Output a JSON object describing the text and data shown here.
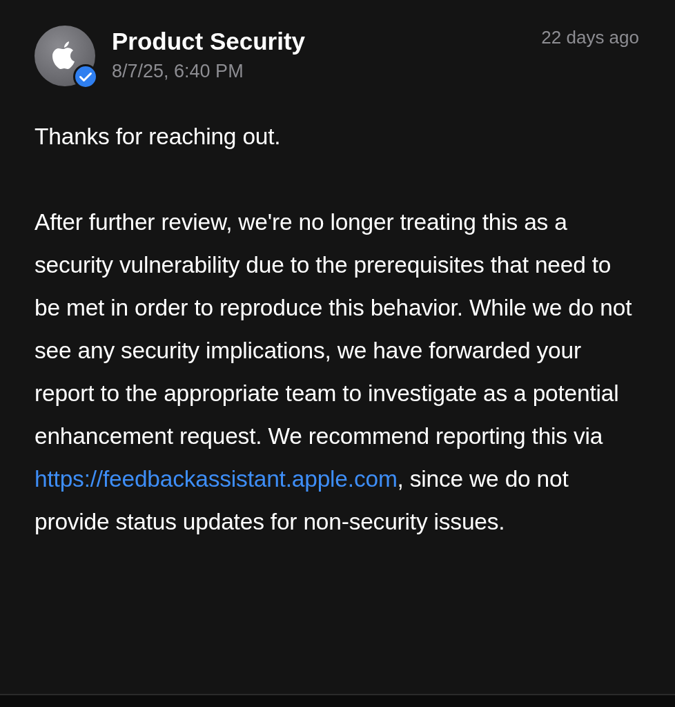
{
  "message": {
    "sender": "Product Security",
    "verified": true,
    "date": "8/7/25, 6:40 PM",
    "age": "22 days ago",
    "greeting": "Thanks for reaching out.",
    "body_before_link": "After further review, we're no longer treating this as a security vulnerability due to the prerequisites that need to be met in order to reproduce this behavior. While we do not see any security implications, we have forwarded your report to the appropriate team to investigate as a potential enhancement request. We recommend reporting this via",
    "link": "https://feedbackassistant.apple.com",
    "body_after_link": ", since we do not provide status updates for non-security issues."
  }
}
